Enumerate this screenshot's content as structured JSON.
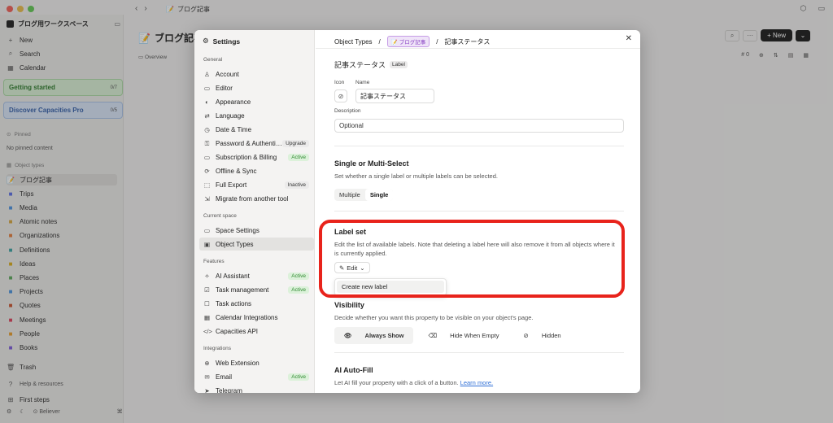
{
  "window": {
    "crumb_icon": "📝",
    "crumb_label": "ブログ記事"
  },
  "sidebar": {
    "workspace": "ブログ用ワークスペース",
    "new": "New",
    "search": "Search",
    "calendar": "Calendar",
    "getting_started": "Getting started",
    "getting_started_count": "0/7",
    "discover": "Discover Capacities Pro",
    "discover_count": "0/5",
    "pinned_header": "Pinned",
    "pinned_empty": "No pinned content",
    "object_types_header": "Object types",
    "object_types": [
      {
        "label": "ブログ記事",
        "icon": "📝",
        "color": "#b7813b"
      },
      {
        "label": "Trips",
        "icon": "■",
        "color": "#5b6ee1"
      },
      {
        "label": "Media",
        "icon": "■",
        "color": "#4b8fdc"
      },
      {
        "label": "Atomic notes",
        "icon": "■",
        "color": "#d2a33f"
      },
      {
        "label": "Organizations",
        "icon": "■",
        "color": "#e07a3b"
      },
      {
        "label": "Definitions",
        "icon": "■",
        "color": "#3aa0a0"
      },
      {
        "label": "Ideas",
        "icon": "■",
        "color": "#d6a91d"
      },
      {
        "label": "Places",
        "icon": "■",
        "color": "#5aa55a"
      },
      {
        "label": "Projects",
        "icon": "■",
        "color": "#4a90d9"
      },
      {
        "label": "Quotes",
        "icon": "■",
        "color": "#c5522e"
      },
      {
        "label": "Meetings",
        "icon": "■",
        "color": "#d8405a"
      },
      {
        "label": "People",
        "icon": "■",
        "color": "#e39a2c"
      },
      {
        "label": "Books",
        "icon": "■",
        "color": "#7b5bd6"
      }
    ],
    "trash": "Trash",
    "help": "Help & resources",
    "first_steps": "First steps",
    "believer": "Believer"
  },
  "page": {
    "title": "ブログ記事",
    "tab_overview": "Overview",
    "new_button": "New",
    "count": "0"
  },
  "settings": {
    "title": "Settings",
    "general_header": "General",
    "general": [
      {
        "label": "Account",
        "icon": "♙"
      },
      {
        "label": "Editor",
        "icon": "▭"
      },
      {
        "label": "Appearance",
        "icon": "◐"
      },
      {
        "label": "Language",
        "icon": "⇄"
      },
      {
        "label": "Date & Time",
        "icon": "◷"
      },
      {
        "label": "Password & Authenti…",
        "icon": "⚿",
        "badge": "Upgrade"
      },
      {
        "label": "Subscription & Billing",
        "icon": "▭",
        "badge": "Active"
      },
      {
        "label": "Offline & Sync",
        "icon": "⟳"
      },
      {
        "label": "Full Export",
        "icon": "⬚",
        "badge": "Inactive"
      },
      {
        "label": "Migrate from another tool",
        "icon": "⇲"
      }
    ],
    "current_space_header": "Current space",
    "current_space": [
      {
        "label": "Space Settings",
        "icon": "▭"
      },
      {
        "label": "Object Types",
        "icon": "▣"
      }
    ],
    "features_header": "Features",
    "features": [
      {
        "label": "AI Assistant",
        "icon": "✧",
        "badge": "Active"
      },
      {
        "label": "Task management",
        "icon": "☑",
        "badge": "Active"
      },
      {
        "label": "Task actions",
        "icon": "☐"
      },
      {
        "label": "Calendar Integrations",
        "icon": "▦"
      },
      {
        "label": "Capacities API",
        "icon": "</>"
      }
    ],
    "integrations_header": "Integrations",
    "integrations": [
      {
        "label": "Web Extension",
        "icon": "⊕"
      },
      {
        "label": "Email",
        "icon": "✉",
        "badge": "Active"
      },
      {
        "label": "Telegram",
        "icon": "➤"
      }
    ]
  },
  "content": {
    "breadcrumb_root": "Object Types",
    "breadcrumb_type": "ブログ記事",
    "breadcrumb_prop": "記事ステータス",
    "property_name": "記事ステータス",
    "property_tag": "Label",
    "icon_label": "Icon",
    "name_label": "Name",
    "name_value": "記事ステータス",
    "description_label": "Description",
    "description_value": "Optional",
    "select_title": "Single or Multi-Select",
    "select_desc": "Set whether a single label or multiple labels can be selected.",
    "select_multiple": "Multiple",
    "select_single": "Single",
    "labelset_title": "Label set",
    "labelset_desc": "Edit the list of available labels. Note that deleting a label here will also remove it from all objects where it is currently applied.",
    "edit_label": "Edit",
    "create_label": "Create new label",
    "visibility_title": "Visibility",
    "visibility_desc": "Decide whether you want this property to be visible on your object's page.",
    "vis_always": "Always Show",
    "vis_hide_empty": "Hide When Empty",
    "vis_hidden": "Hidden",
    "autofill_title": "AI Auto-Fill",
    "autofill_desc": "Let AI fill your property with a click of a button.",
    "learn_more": "Learn more."
  },
  "colors": {
    "highlight": "#e8231b",
    "accent_purple": "#8a45c4",
    "active_green": "#2f8a30"
  }
}
